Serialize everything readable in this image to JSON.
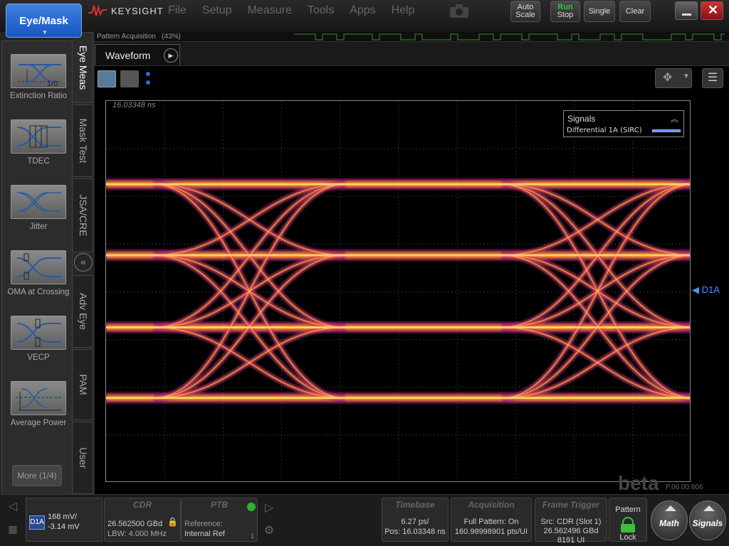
{
  "app_button": "Eye/Mask",
  "logo": "KEYSIGHT",
  "menu": [
    "File",
    "Setup",
    "Measure",
    "Tools",
    "Apps",
    "Help"
  ],
  "toolbar": {
    "auto_scale_line1": "Auto",
    "auto_scale_line2": "Scale",
    "run_line1": "Run",
    "run_line2": "Stop",
    "single": "Single",
    "clear": "Clear"
  },
  "colors": {
    "accent": "#2f6fd6",
    "run_green": "#35c235",
    "close_red": "#c21c1c",
    "signal_blue": "#5a8cff"
  },
  "pattern_acquisition": {
    "label": "Pattern Acquisition",
    "percent": "(43%)",
    "progress": 0.43
  },
  "left_tools": [
    {
      "label": "Extinction Ratio",
      "icon": "extinction-ratio-icon",
      "icon_text": "1/0"
    },
    {
      "label": "TDEC",
      "icon": "tdec-icon",
      "icon_text": ""
    },
    {
      "label": "Jitter",
      "icon": "jitter-icon",
      "icon_text": ""
    },
    {
      "label": "OMA at Crossing",
      "icon": "oma-at-crossing-icon",
      "icon_text": ""
    },
    {
      "label": "VECP",
      "icon": "vecp-icon",
      "icon_text": ""
    },
    {
      "label": "Average Power",
      "icon": "average-power-icon",
      "icon_text": ""
    }
  ],
  "more_button": "More (1/4)",
  "vertical_tabs": [
    "Eye Meas",
    "Mask Test",
    "JSA/CRE",
    "Adv Eye",
    "PAM",
    "User"
  ],
  "waveform_tab": "Waveform",
  "time_readout": "16.03348 ns",
  "signals_legend": {
    "title": "Signals",
    "entry": "Differential 1A (SIRC)"
  },
  "channel_marker": "D1A",
  "beta_text": "beta",
  "version": "P.06.00.606",
  "bottom": {
    "channel": {
      "tag": "D1A",
      "volts": "168 mV/",
      "offset": "-3.14 mV"
    },
    "cdr": {
      "title": "CDR",
      "rate": "26.562500 GBd",
      "lbw": "LBW:  4.000 MHz"
    },
    "ptb": {
      "title": "PTB",
      "ref_label": "Reference:",
      "ref_value": "Internal Ref",
      "count": "1"
    },
    "timebase": {
      "title": "Timebase",
      "scale": "6.27 ps/",
      "pos": "Pos: 16.03348 ns"
    },
    "acquisition": {
      "title": "Acquisition",
      "mode": "Full Pattern:  On",
      "pts": "160.98998901 pts/UI"
    },
    "frame_trigger": {
      "title": "Frame Trigger",
      "src": "Src: CDR (Slot 1)",
      "rate": "26.562496 GBd",
      "ui": "8191 UI"
    },
    "pattern_lock": {
      "title": "Pattern",
      "label": "Lock"
    },
    "math": "Math",
    "signals": "Signals"
  }
}
